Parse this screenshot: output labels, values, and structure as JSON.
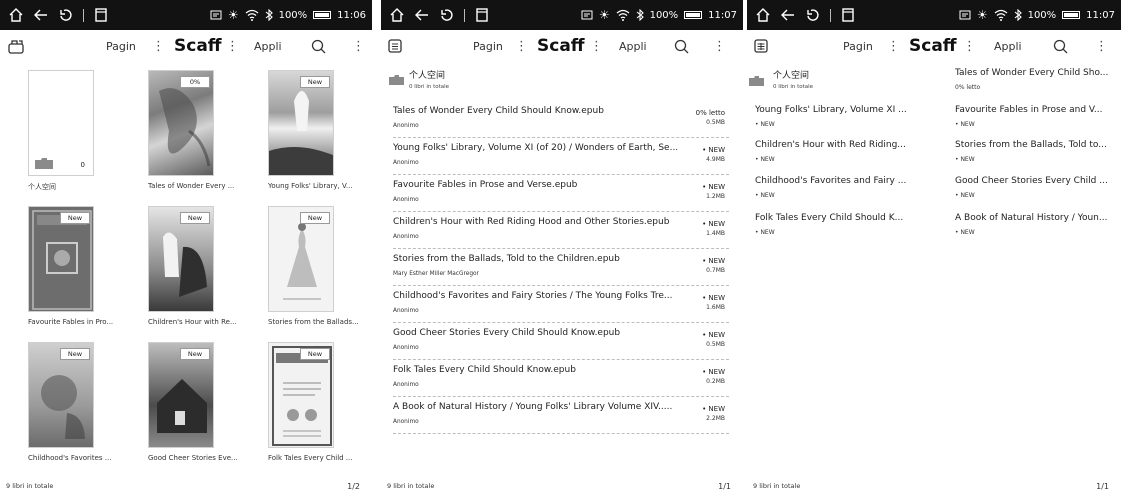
{
  "status": {
    "time_1": "11:06",
    "time_2": "11:07",
    "time_3": "11:07",
    "battery": "100%"
  },
  "toolbar": {
    "pagine": "Pagin",
    "scaffale": "Scaff",
    "appli": "Appli"
  },
  "folder": {
    "name": "个人空间",
    "count": "0",
    "sub": "0 libri in totale"
  },
  "grid": {
    "items": [
      {
        "caption": "个人空间",
        "badge": ""
      },
      {
        "caption": "Tales of Wonder Every ...",
        "badge": "0%"
      },
      {
        "caption": "Young Folks' Library, V...",
        "badge": "New"
      },
      {
        "caption": "Favourite Fables in Pro...",
        "badge": "New"
      },
      {
        "caption": "Children's Hour with Re...",
        "badge": "New"
      },
      {
        "caption": "Stories from the Ballads...",
        "badge": "New"
      },
      {
        "caption": "Childhood's Favorites ...",
        "badge": "New"
      },
      {
        "caption": "Good Cheer Stories Eve...",
        "badge": "New"
      },
      {
        "caption": "Folk Tales Every Child ...",
        "badge": "New"
      }
    ],
    "footer_left": "9 libri in totale",
    "footer_right": "1/2"
  },
  "list": {
    "rows": [
      {
        "title": "Tales of Wonder Every Child Should Know.epub",
        "author": "Anonimo",
        "status": "0% letto",
        "size": "0.5MB"
      },
      {
        "title": "Young Folks' Library, Volume XI (of 20) / Wonders of Earth, Se...",
        "author": "Anonimo",
        "status": "• NEW",
        "size": "4.9MB"
      },
      {
        "title": "Favourite Fables in Prose and Verse.epub",
        "author": "Anonimo",
        "status": "• NEW",
        "size": "1.2MB"
      },
      {
        "title": "Children's Hour with Red Riding Hood and Other Stories.epub",
        "author": "Anonimo",
        "status": "• NEW",
        "size": "1.4MB"
      },
      {
        "title": "Stories from the Ballads, Told to the Children.epub",
        "author": "Mary Esther Miller MacGregor",
        "status": "• NEW",
        "size": "0.7MB"
      },
      {
        "title": "Childhood's Favorites and Fairy Stories / The Young Folks Tre...",
        "author": "Anonimo",
        "status": "• NEW",
        "size": "1.6MB"
      },
      {
        "title": "Good Cheer Stories Every Child Should Know.epub",
        "author": "Anonimo",
        "status": "• NEW",
        "size": "0.5MB"
      },
      {
        "title": "Folk Tales Every Child Should Know.epub",
        "author": "Anonimo",
        "status": "• NEW",
        "size": "0.2MB"
      },
      {
        "title": "A Book of Natural History / Young Folks' Library Volume XIV.....",
        "author": "Anonimo",
        "status": "• NEW",
        "size": "2.2MB"
      }
    ],
    "footer_left": "9 libri in totale",
    "footer_right": "1/1"
  },
  "compact": {
    "left": [
      {
        "title": "Young Folks' Library, Volume XI ...",
        "status": "• NEW"
      },
      {
        "title": "Children's Hour with Red Riding...",
        "status": "• NEW"
      },
      {
        "title": "Childhood's Favorites and Fairy ...",
        "status": "• NEW"
      },
      {
        "title": "Folk Tales Every Child Should K...",
        "status": "• NEW"
      }
    ],
    "right": [
      {
        "title": "Tales of Wonder Every Child Sho...",
        "status": "0% letto"
      },
      {
        "title": "Favourite Fables in Prose and V...",
        "status": "• NEW"
      },
      {
        "title": "Stories from the Ballads, Told to...",
        "status": "• NEW"
      },
      {
        "title": "Good Cheer Stories Every Child ...",
        "status": "• NEW"
      },
      {
        "title": "A Book of Natural History / Youn...",
        "status": "• NEW"
      }
    ],
    "footer_left": "9 libri in totale",
    "footer_right": "1/1"
  }
}
